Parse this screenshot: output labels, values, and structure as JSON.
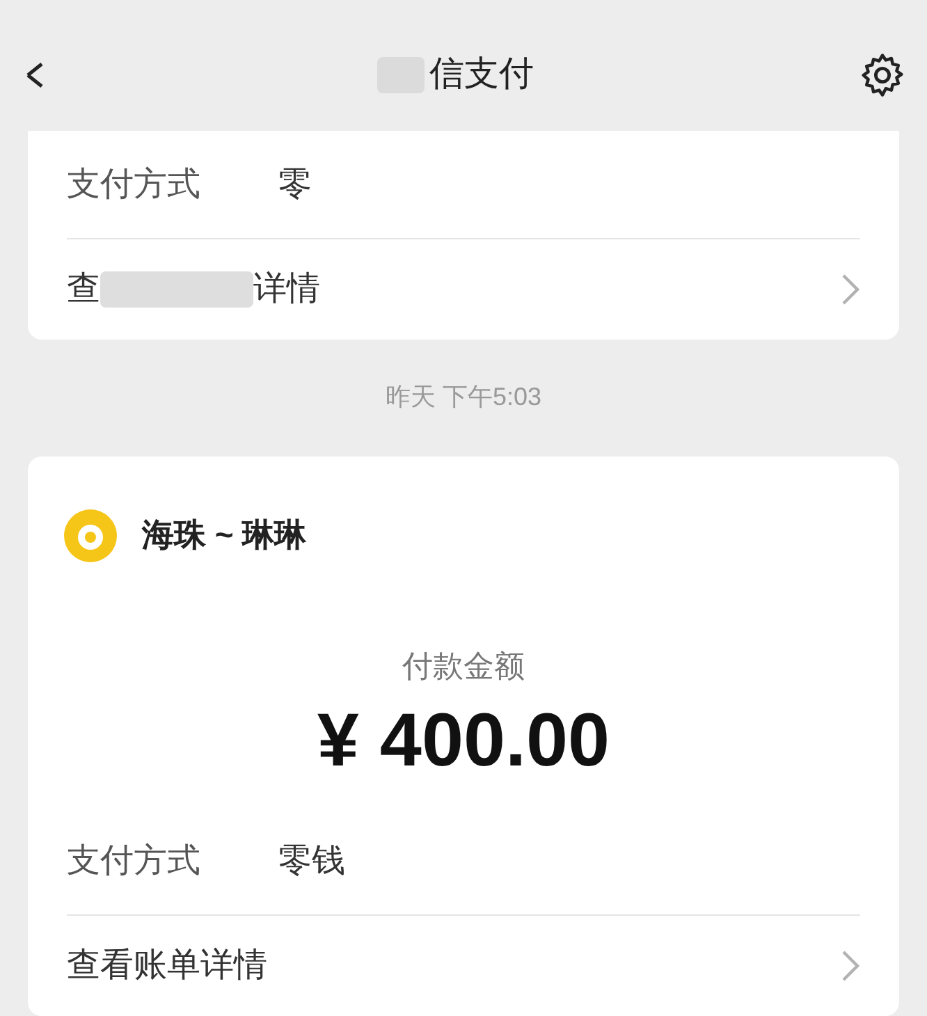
{
  "header": {
    "title": "信支付"
  },
  "cards": [
    {
      "rows": [
        {
          "kind": "field",
          "label": "支付方式",
          "value": "零"
        },
        {
          "kind": "link",
          "label_start": "查",
          "label_end": "详情"
        }
      ]
    },
    {
      "timestamp": "昨天 下午5:03",
      "merchant": "海珠 ~ 琳琳",
      "amount_label": "付款金额",
      "amount": "¥ 400.00",
      "rows": [
        {
          "kind": "field",
          "label": "支付方式",
          "value": "零钱"
        },
        {
          "kind": "link",
          "label_start": "查看账单详情",
          "label_end": ""
        }
      ]
    }
  ]
}
